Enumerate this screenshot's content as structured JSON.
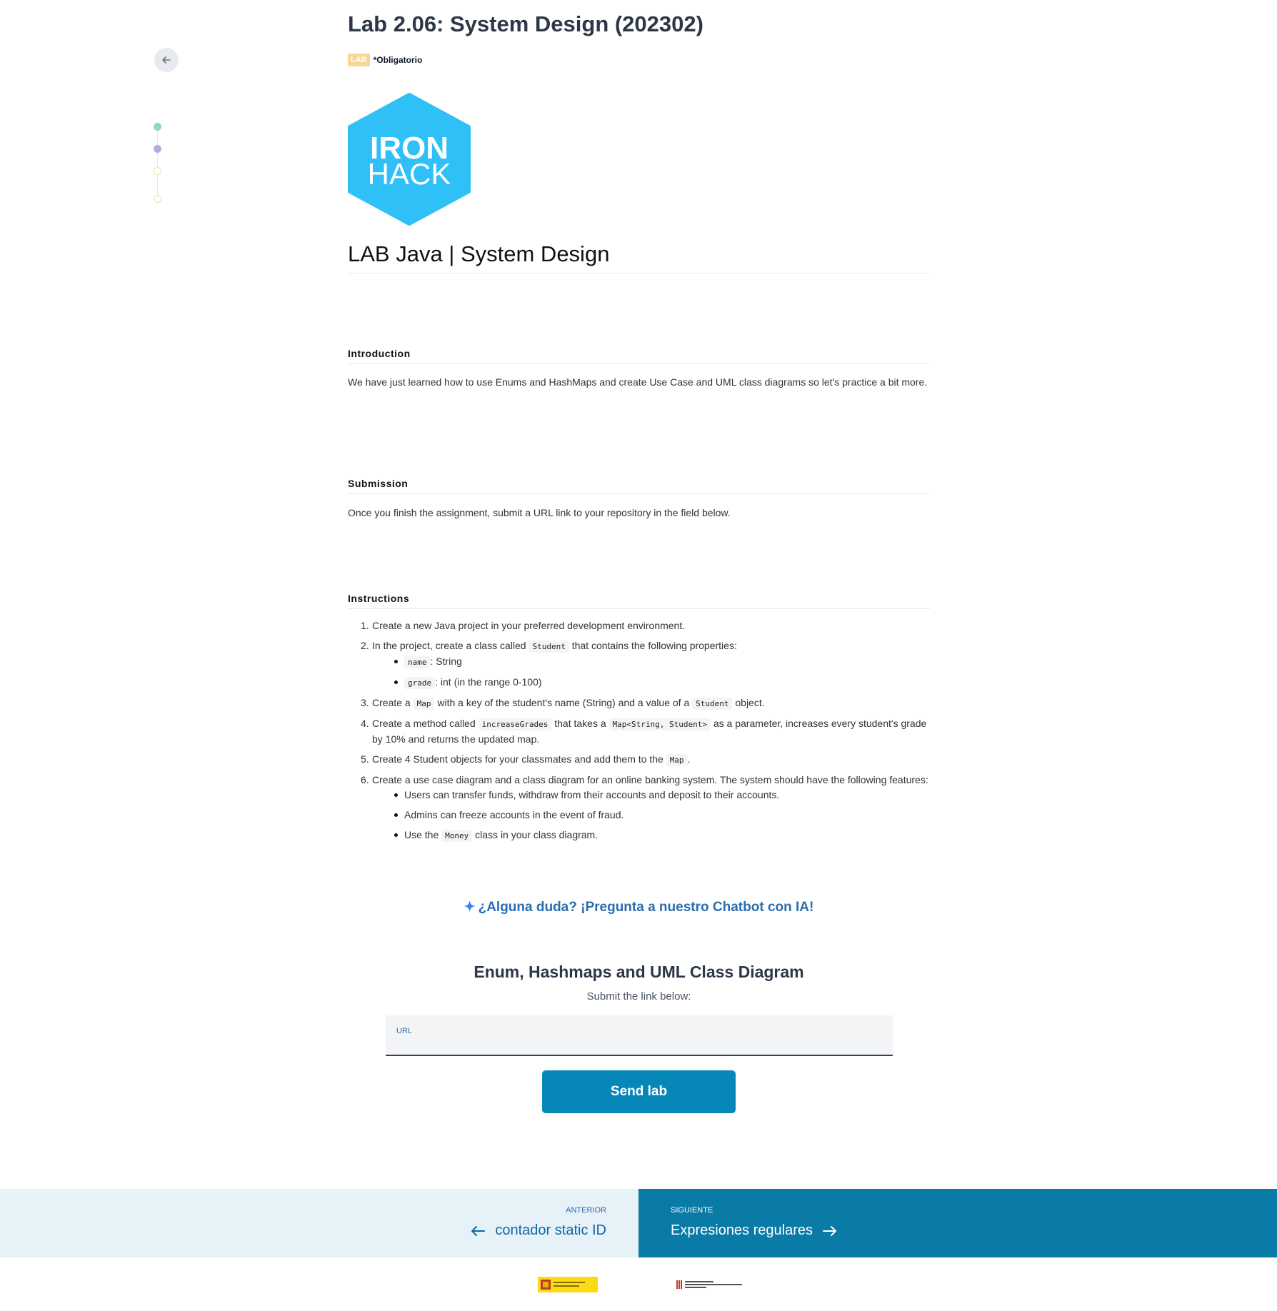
{
  "header": {
    "title": "Lab 2.06: System Design (202302)",
    "badge": "LAB",
    "required": "*Obligatorio"
  },
  "logo": {
    "line1": "IRON",
    "line2": "HACK",
    "color": "#2fc0f8"
  },
  "doc": {
    "h1": "LAB Java | System Design",
    "introduction": {
      "heading": "Introduction",
      "text": "We have just learned how to use Enums and HashMaps and create Use Case and UML class diagrams so let's practice a bit more."
    },
    "submission": {
      "heading": "Submission",
      "text": "Once you finish the assignment, submit a URL link to your repository in the field below."
    },
    "instructions": {
      "heading": "Instructions",
      "steps": [
        {
          "num": "1.",
          "text": "Create a new Java project in your preferred development environment."
        },
        {
          "num": "2.",
          "a": "In the project, create a class called ",
          "code1": "Student",
          "b": " that contains the following properties:",
          "sub": [
            {
              "code": "name",
              "text": ": String"
            },
            {
              "code": "grade",
              "text": ": int (in the range 0-100)"
            }
          ]
        },
        {
          "num": "3.",
          "a": "Create a ",
          "code1": "Map",
          "b": " with a key of the student's name (String) and a value of a ",
          "code2": "Student",
          "c": " object."
        },
        {
          "num": "4.",
          "a": "Create a method called ",
          "code1": "increaseGrades",
          "b": " that takes a ",
          "code2": "Map<String, Student>",
          "c": " as a parameter, increases every student's grade by 10% and returns the updated map."
        },
        {
          "num": "5.",
          "a": "Create 4 Student objects for your classmates and add them to the ",
          "code1": "Map",
          "b": "."
        },
        {
          "num": "6.",
          "text": "Create a use case diagram and a class diagram for an online banking system. The system should have the following features:",
          "sub": [
            {
              "text": "Users can transfer funds, withdraw from their accounts and deposit to their accounts."
            },
            {
              "text": "Admins can freeze accounts in the event of fraud."
            },
            {
              "a": "Use the ",
              "code": "Money",
              "b": " class in your class diagram."
            }
          ]
        }
      ]
    }
  },
  "chatbot": {
    "text": "¿Alguna duda? ¡Pregunta a nuestro Chatbot con IA!"
  },
  "submit": {
    "title": "Enum, Hashmaps and UML Class Diagram",
    "subtitle": "Submit the link below:",
    "field_label": "URL",
    "field_value": "",
    "button": "Send lab"
  },
  "pager": {
    "prev_kicker": "ANTERIOR",
    "prev_title": "contador static ID",
    "next_kicker": "SIGUIENTE",
    "next_title": "Expresiones regulares"
  },
  "icons": {
    "back": "arrow-left-icon",
    "spark": "sparkles-icon",
    "prev": "arrow-left-icon",
    "next": "arrow-right-icon"
  },
  "colors": {
    "accent": "#0786b8",
    "pager_next_bg": "#0a7aa6",
    "pager_prev_bg": "#e7f1f8",
    "badge_bg": "#f8d69a"
  }
}
